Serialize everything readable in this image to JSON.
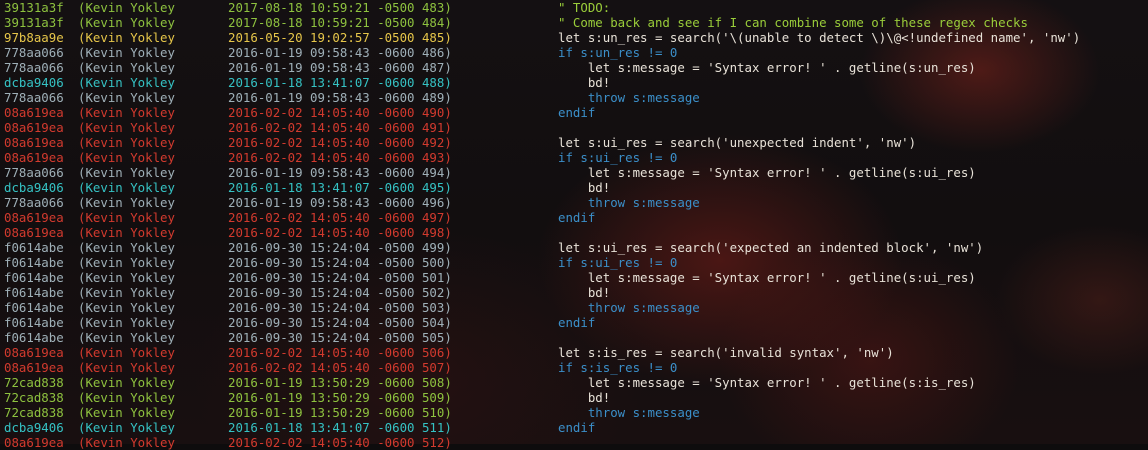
{
  "colors": {
    "green": "#8ec23f",
    "yellow": "#e6c64a",
    "gray": "#9fb0b8",
    "cyan": "#35c2c4",
    "red": "#d23a2e"
  },
  "blame": {
    "rows": [
      {
        "hash": "39131a3f",
        "author": "(Kevin Yokley",
        "date": "2017-08-18 10:59:21 -0500 483)",
        "color": "green"
      },
      {
        "hash": "39131a3f",
        "author": "(Kevin Yokley",
        "date": "2017-08-18 10:59:21 -0500 484)",
        "color": "green"
      },
      {
        "hash": "97b8aa9e",
        "author": "(Kevin Yokley",
        "date": "2016-05-20 19:02:57 -0500 485)",
        "color": "yellow"
      },
      {
        "hash": "778aa066",
        "author": "(Kevin Yokley",
        "date": "2016-01-19 09:58:43 -0600 486)",
        "color": "gray"
      },
      {
        "hash": "778aa066",
        "author": "(Kevin Yokley",
        "date": "2016-01-19 09:58:43 -0600 487)",
        "color": "gray"
      },
      {
        "hash": "dcba9406",
        "author": "(Kevin Yokley",
        "date": "2016-01-18 13:41:07 -0600 488)",
        "color": "cyan"
      },
      {
        "hash": "778aa066",
        "author": "(Kevin Yokley",
        "date": "2016-01-19 09:58:43 -0600 489)",
        "color": "gray"
      },
      {
        "hash": "08a619ea",
        "author": "(Kevin Yokley",
        "date": "2016-02-02 14:05:40 -0600 490)",
        "color": "red"
      },
      {
        "hash": "08a619ea",
        "author": "(Kevin Yokley",
        "date": "2016-02-02 14:05:40 -0600 491)",
        "color": "red"
      },
      {
        "hash": "08a619ea",
        "author": "(Kevin Yokley",
        "date": "2016-02-02 14:05:40 -0600 492)",
        "color": "red"
      },
      {
        "hash": "08a619ea",
        "author": "(Kevin Yokley",
        "date": "2016-02-02 14:05:40 -0600 493)",
        "color": "red"
      },
      {
        "hash": "778aa066",
        "author": "(Kevin Yokley",
        "date": "2016-01-19 09:58:43 -0600 494)",
        "color": "gray"
      },
      {
        "hash": "dcba9406",
        "author": "(Kevin Yokley",
        "date": "2016-01-18 13:41:07 -0600 495)",
        "color": "cyan"
      },
      {
        "hash": "778aa066",
        "author": "(Kevin Yokley",
        "date": "2016-01-19 09:58:43 -0600 496)",
        "color": "gray"
      },
      {
        "hash": "08a619ea",
        "author": "(Kevin Yokley",
        "date": "2016-02-02 14:05:40 -0600 497)",
        "color": "red"
      },
      {
        "hash": "08a619ea",
        "author": "(Kevin Yokley",
        "date": "2016-02-02 14:05:40 -0600 498)",
        "color": "red"
      },
      {
        "hash": "f0614abe",
        "author": "(Kevin Yokley",
        "date": "2016-09-30 15:24:04 -0500 499)",
        "color": "gray"
      },
      {
        "hash": "f0614abe",
        "author": "(Kevin Yokley",
        "date": "2016-09-30 15:24:04 -0500 500)",
        "color": "gray"
      },
      {
        "hash": "f0614abe",
        "author": "(Kevin Yokley",
        "date": "2016-09-30 15:24:04 -0500 501)",
        "color": "gray"
      },
      {
        "hash": "f0614abe",
        "author": "(Kevin Yokley",
        "date": "2016-09-30 15:24:04 -0500 502)",
        "color": "gray"
      },
      {
        "hash": "f0614abe",
        "author": "(Kevin Yokley",
        "date": "2016-09-30 15:24:04 -0500 503)",
        "color": "gray"
      },
      {
        "hash": "f0614abe",
        "author": "(Kevin Yokley",
        "date": "2016-09-30 15:24:04 -0500 504)",
        "color": "gray"
      },
      {
        "hash": "f0614abe",
        "author": "(Kevin Yokley",
        "date": "2016-09-30 15:24:04 -0500 505)",
        "color": "gray"
      },
      {
        "hash": "08a619ea",
        "author": "(Kevin Yokley",
        "date": "2016-02-02 14:05:40 -0600 506)",
        "color": "red"
      },
      {
        "hash": "08a619ea",
        "author": "(Kevin Yokley",
        "date": "2016-02-02 14:05:40 -0600 507)",
        "color": "red"
      },
      {
        "hash": "72cad838",
        "author": "(Kevin Yokley",
        "date": "2016-01-19 13:50:29 -0600 508)",
        "color": "green"
      },
      {
        "hash": "72cad838",
        "author": "(Kevin Yokley",
        "date": "2016-01-19 13:50:29 -0600 509)",
        "color": "green"
      },
      {
        "hash": "72cad838",
        "author": "(Kevin Yokley",
        "date": "2016-01-19 13:50:29 -0600 510)",
        "color": "green"
      },
      {
        "hash": "dcba9406",
        "author": "(Kevin Yokley",
        "date": "2016-01-18 13:41:07 -0600 511)",
        "color": "cyan"
      },
      {
        "hash": "08a619ea",
        "author": "(Kevin Yokley",
        "date": "2016-02-02 14:05:40 -0600 512)",
        "color": "red"
      }
    ]
  },
  "code": {
    "lines": [
      {
        "text": "\" TODO:",
        "kind": "comment"
      },
      {
        "text": "\" Come back and see if I can combine some of these regex checks",
        "kind": "comment"
      },
      {
        "text": "let s:un_res = search('\\(unable to detect \\)\\@<!undefined name', 'nw')",
        "kind": "code"
      },
      {
        "text": "if s:un_res != 0",
        "kind": "kw"
      },
      {
        "text": "    let s:message = 'Syntax error! ' . getline(s:un_res)",
        "kind": "code"
      },
      {
        "text": "    bd!",
        "kind": "code"
      },
      {
        "text": "    throw s:message",
        "kind": "kw"
      },
      {
        "text": "endif",
        "kind": "kw"
      },
      {
        "text": "",
        "kind": "code"
      },
      {
        "text": "let s:ui_res = search('unexpected indent', 'nw')",
        "kind": "code"
      },
      {
        "text": "if s:ui_res != 0",
        "kind": "kw"
      },
      {
        "text": "    let s:message = 'Syntax error! ' . getline(s:ui_res)",
        "kind": "code"
      },
      {
        "text": "    bd!",
        "kind": "code"
      },
      {
        "text": "    throw s:message",
        "kind": "kw"
      },
      {
        "text": "endif",
        "kind": "kw"
      },
      {
        "text": "",
        "kind": "code"
      },
      {
        "text": "let s:ui_res = search('expected an indented block', 'nw')",
        "kind": "code"
      },
      {
        "text": "if s:ui_res != 0",
        "kind": "kw"
      },
      {
        "text": "    let s:message = 'Syntax error! ' . getline(s:ui_res)",
        "kind": "code"
      },
      {
        "text": "    bd!",
        "kind": "code"
      },
      {
        "text": "    throw s:message",
        "kind": "kw"
      },
      {
        "text": "endif",
        "kind": "kw"
      },
      {
        "text": "",
        "kind": "code"
      },
      {
        "text": "let s:is_res = search('invalid syntax', 'nw')",
        "kind": "code"
      },
      {
        "text": "if s:is_res != 0",
        "kind": "kw"
      },
      {
        "text": "    let s:message = 'Syntax error! ' . getline(s:is_res)",
        "kind": "code"
      },
      {
        "text": "    bd!",
        "kind": "code"
      },
      {
        "text": "    throw s:message",
        "kind": "kw"
      },
      {
        "text": "endif",
        "kind": "kw"
      },
      {
        "text": "",
        "kind": "code"
      }
    ]
  }
}
